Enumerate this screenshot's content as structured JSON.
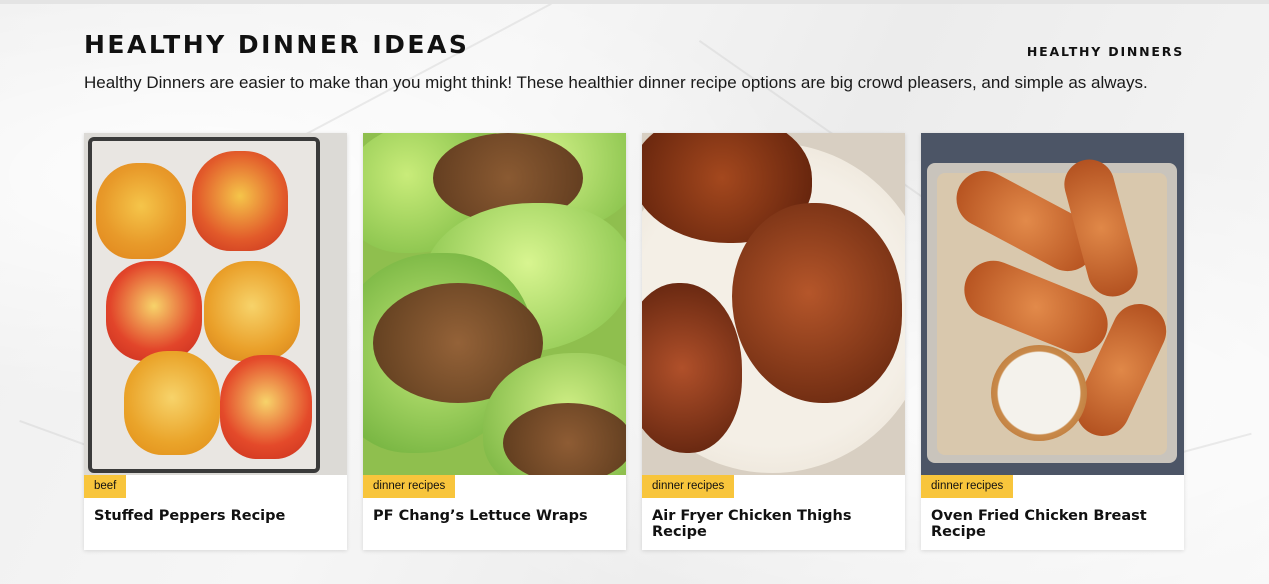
{
  "section": {
    "title": "HEALTHY DINNER IDEAS",
    "link": "HEALTHY DINNERS",
    "description": "Healthy Dinners are easier to make than you might think! These healthier dinner recipe options are big crowd pleasers, and simple as always."
  },
  "colors": {
    "badge": "#f8c53c",
    "text": "#111111",
    "card_bg": "#ffffff"
  },
  "cards": [
    {
      "category": "beef",
      "title": "Stuffed Peppers Recipe",
      "image": "stuffed-peppers-image"
    },
    {
      "category": "dinner recipes",
      "title": "PF Chang’s Lettuce Wraps",
      "image": "lettuce-wraps-image"
    },
    {
      "category": "dinner recipes",
      "title": "Air Fryer Chicken Thighs Recipe",
      "image": "chicken-thighs-image"
    },
    {
      "category": "dinner recipes",
      "title": "Oven Fried Chicken Breast Recipe",
      "image": "chicken-breast-image"
    }
  ]
}
